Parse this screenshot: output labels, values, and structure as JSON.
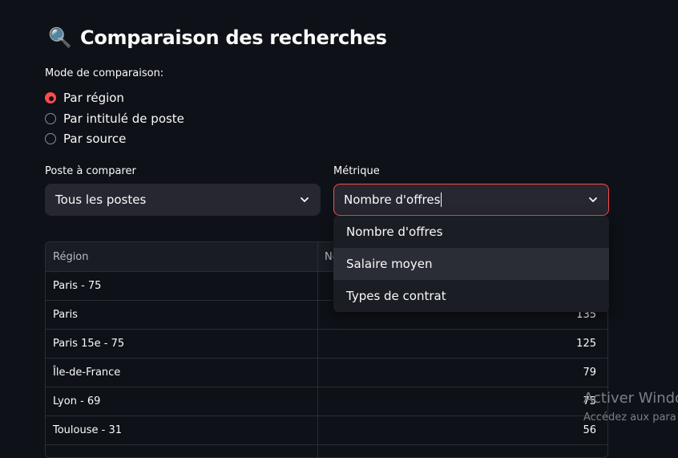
{
  "page": {
    "title": "Comparaison des recherches",
    "title_icon": "🔍",
    "title_icon_name": "magnifier-icon"
  },
  "mode": {
    "label": "Mode de comparaison:",
    "options": [
      {
        "label": "Par région",
        "checked": true
      },
      {
        "label": "Par intitulé de poste",
        "checked": false
      },
      {
        "label": "Par source",
        "checked": false
      }
    ]
  },
  "poste": {
    "label": "Poste à comparer",
    "value": "Tous les postes"
  },
  "metrique": {
    "label": "Métrique",
    "value": "Nombre d'offres",
    "accent": "#ff4b4b",
    "dropdown": [
      "Nombre d'offres",
      "Salaire moyen",
      "Types de contrat"
    ]
  },
  "table": {
    "headers": [
      "Région",
      "No"
    ],
    "rows": [
      {
        "region": "Paris - 75",
        "value": ""
      },
      {
        "region": "Paris",
        "value": "135"
      },
      {
        "region": "Paris 15e - 75",
        "value": "125"
      },
      {
        "region": "Île-de-France",
        "value": "79"
      },
      {
        "region": "Lyon - 69",
        "value": "75"
      },
      {
        "region": "Toulouse - 31",
        "value": "56"
      }
    ]
  },
  "watermark": {
    "line1": "Activer Windo",
    "line2": "Accédez aux para"
  }
}
